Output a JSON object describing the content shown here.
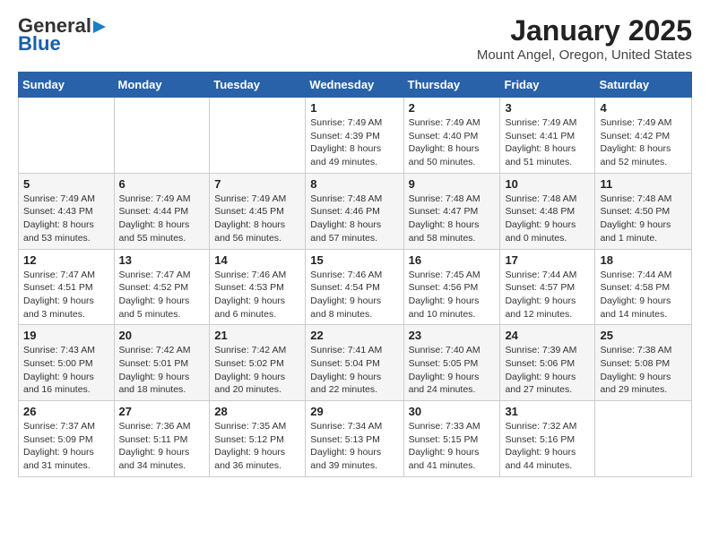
{
  "app": {
    "logo_general": "General",
    "logo_blue": "Blue"
  },
  "title": "January 2025",
  "subtitle": "Mount Angel, Oregon, United States",
  "weekdays": [
    "Sunday",
    "Monday",
    "Tuesday",
    "Wednesday",
    "Thursday",
    "Friday",
    "Saturday"
  ],
  "weeks": [
    [
      {
        "day": "",
        "info": ""
      },
      {
        "day": "",
        "info": ""
      },
      {
        "day": "",
        "info": ""
      },
      {
        "day": "1",
        "info": "Sunrise: 7:49 AM\nSunset: 4:39 PM\nDaylight: 8 hours\nand 49 minutes."
      },
      {
        "day": "2",
        "info": "Sunrise: 7:49 AM\nSunset: 4:40 PM\nDaylight: 8 hours\nand 50 minutes."
      },
      {
        "day": "3",
        "info": "Sunrise: 7:49 AM\nSunset: 4:41 PM\nDaylight: 8 hours\nand 51 minutes."
      },
      {
        "day": "4",
        "info": "Sunrise: 7:49 AM\nSunset: 4:42 PM\nDaylight: 8 hours\nand 52 minutes."
      }
    ],
    [
      {
        "day": "5",
        "info": "Sunrise: 7:49 AM\nSunset: 4:43 PM\nDaylight: 8 hours\nand 53 minutes."
      },
      {
        "day": "6",
        "info": "Sunrise: 7:49 AM\nSunset: 4:44 PM\nDaylight: 8 hours\nand 55 minutes."
      },
      {
        "day": "7",
        "info": "Sunrise: 7:49 AM\nSunset: 4:45 PM\nDaylight: 8 hours\nand 56 minutes."
      },
      {
        "day": "8",
        "info": "Sunrise: 7:48 AM\nSunset: 4:46 PM\nDaylight: 8 hours\nand 57 minutes."
      },
      {
        "day": "9",
        "info": "Sunrise: 7:48 AM\nSunset: 4:47 PM\nDaylight: 8 hours\nand 58 minutes."
      },
      {
        "day": "10",
        "info": "Sunrise: 7:48 AM\nSunset: 4:48 PM\nDaylight: 9 hours\nand 0 minutes."
      },
      {
        "day": "11",
        "info": "Sunrise: 7:48 AM\nSunset: 4:50 PM\nDaylight: 9 hours\nand 1 minute."
      }
    ],
    [
      {
        "day": "12",
        "info": "Sunrise: 7:47 AM\nSunset: 4:51 PM\nDaylight: 9 hours\nand 3 minutes."
      },
      {
        "day": "13",
        "info": "Sunrise: 7:47 AM\nSunset: 4:52 PM\nDaylight: 9 hours\nand 5 minutes."
      },
      {
        "day": "14",
        "info": "Sunrise: 7:46 AM\nSunset: 4:53 PM\nDaylight: 9 hours\nand 6 minutes."
      },
      {
        "day": "15",
        "info": "Sunrise: 7:46 AM\nSunset: 4:54 PM\nDaylight: 9 hours\nand 8 minutes."
      },
      {
        "day": "16",
        "info": "Sunrise: 7:45 AM\nSunset: 4:56 PM\nDaylight: 9 hours\nand 10 minutes."
      },
      {
        "day": "17",
        "info": "Sunrise: 7:44 AM\nSunset: 4:57 PM\nDaylight: 9 hours\nand 12 minutes."
      },
      {
        "day": "18",
        "info": "Sunrise: 7:44 AM\nSunset: 4:58 PM\nDaylight: 9 hours\nand 14 minutes."
      }
    ],
    [
      {
        "day": "19",
        "info": "Sunrise: 7:43 AM\nSunset: 5:00 PM\nDaylight: 9 hours\nand 16 minutes."
      },
      {
        "day": "20",
        "info": "Sunrise: 7:42 AM\nSunset: 5:01 PM\nDaylight: 9 hours\nand 18 minutes."
      },
      {
        "day": "21",
        "info": "Sunrise: 7:42 AM\nSunset: 5:02 PM\nDaylight: 9 hours\nand 20 minutes."
      },
      {
        "day": "22",
        "info": "Sunrise: 7:41 AM\nSunset: 5:04 PM\nDaylight: 9 hours\nand 22 minutes."
      },
      {
        "day": "23",
        "info": "Sunrise: 7:40 AM\nSunset: 5:05 PM\nDaylight: 9 hours\nand 24 minutes."
      },
      {
        "day": "24",
        "info": "Sunrise: 7:39 AM\nSunset: 5:06 PM\nDaylight: 9 hours\nand 27 minutes."
      },
      {
        "day": "25",
        "info": "Sunrise: 7:38 AM\nSunset: 5:08 PM\nDaylight: 9 hours\nand 29 minutes."
      }
    ],
    [
      {
        "day": "26",
        "info": "Sunrise: 7:37 AM\nSunset: 5:09 PM\nDaylight: 9 hours\nand 31 minutes."
      },
      {
        "day": "27",
        "info": "Sunrise: 7:36 AM\nSunset: 5:11 PM\nDaylight: 9 hours\nand 34 minutes."
      },
      {
        "day": "28",
        "info": "Sunrise: 7:35 AM\nSunset: 5:12 PM\nDaylight: 9 hours\nand 36 minutes."
      },
      {
        "day": "29",
        "info": "Sunrise: 7:34 AM\nSunset: 5:13 PM\nDaylight: 9 hours\nand 39 minutes."
      },
      {
        "day": "30",
        "info": "Sunrise: 7:33 AM\nSunset: 5:15 PM\nDaylight: 9 hours\nand 41 minutes."
      },
      {
        "day": "31",
        "info": "Sunrise: 7:32 AM\nSunset: 5:16 PM\nDaylight: 9 hours\nand 44 minutes."
      },
      {
        "day": "",
        "info": ""
      }
    ]
  ]
}
